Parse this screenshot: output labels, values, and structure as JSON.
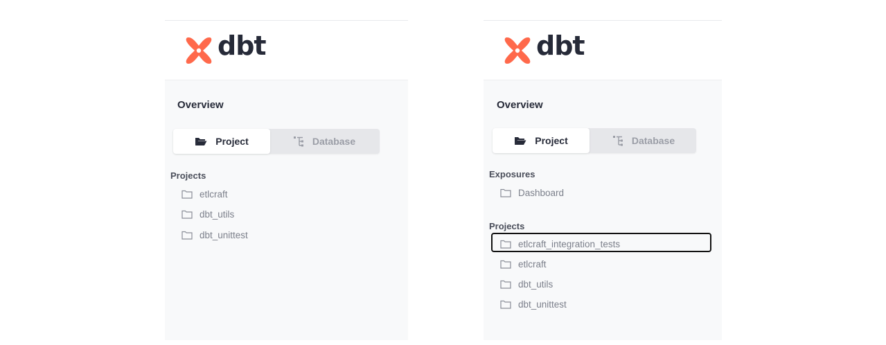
{
  "left_panel": {
    "brand": "dbt",
    "overview_title": "Overview",
    "tabs": {
      "project_label": "Project",
      "database_label": "Database"
    },
    "projects_title": "Projects",
    "projects": [
      "etlcraft",
      "dbt_utils",
      "dbt_unittest"
    ]
  },
  "right_panel": {
    "brand": "dbt",
    "overview_title": "Overview",
    "tabs": {
      "project_label": "Project",
      "database_label": "Database"
    },
    "exposures_title": "Exposures",
    "exposures": [
      "Dashboard"
    ],
    "projects_title": "Projects",
    "projects": [
      "etlcraft_integration_tests",
      "etlcraft",
      "dbt_utils",
      "dbt_unittest"
    ]
  },
  "colors": {
    "brand_orange": "#ff694b",
    "text_dark": "#262a38",
    "panel_bg": "#f8f9fa"
  }
}
